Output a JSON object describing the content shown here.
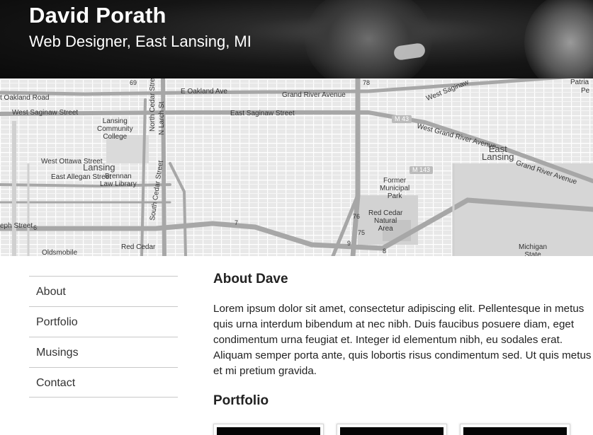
{
  "header": {
    "title": "David Porath",
    "subtitle": "Web Designer, East Lansing, MI"
  },
  "map": {
    "labels": {
      "oakland_road": "t Oakland Road",
      "e_oakland": "E Oakland Ave",
      "grand_river_1": "Grand River Avenue",
      "west_saginaw_tr": "West Saginaw",
      "patria": "Patria",
      "pe": "Pe",
      "west_saginaw_st": "West Saginaw Street",
      "east_saginaw_st": "East Saginaw Street",
      "m43": "M 43",
      "w_grand_river": "West Grand River Avenue",
      "lansing_cc": "Lansing\nCommunity\nCollege",
      "north_cedar": "North Cedar Street",
      "n_larch": "N Larch St",
      "east_lansing": "East\nLansing",
      "grand_river_ave": "Grand River Avenue",
      "west_ottawa": "West Ottawa Street",
      "lansing": "Lansing",
      "east_allegan": "East Allegan Street",
      "brennan": "Brennan\nLaw Library",
      "south_cedar": "South Cedar Street",
      "former_park": "Former\nMunicipal\nPark",
      "m143": "M 143",
      "red_cedar_area": "Red Cedar\nNatural\nArea",
      "eph_street": "eph Street",
      "red_cedar": "Red Cedar",
      "oldsmobile": "Oldsmobile",
      "michigan_state": "Michigan\nState",
      "route_69": "69",
      "route_78": "78",
      "route_76": "76",
      "route_75": "75",
      "route_7": "7",
      "route_9": "9",
      "route_8": "8",
      "route_6": "6"
    }
  },
  "nav": {
    "items": [
      {
        "label": "About"
      },
      {
        "label": "Portfolio"
      },
      {
        "label": "Musings"
      },
      {
        "label": "Contact"
      }
    ]
  },
  "about": {
    "title": "About Dave",
    "body": "Lorem ipsum dolor sit amet, consectetur adipiscing elit. Pellentesque in metus quis urna interdum bibendum at nec nibh. Duis faucibus posuere diam, eget condimentum urna feugiat et. Integer id elementum nibh, eu sodales erat. Aliquam semper porta ante, quis lobortis risus condimentum sed. Ut quis metus et mi pretium gravida."
  },
  "portfolio": {
    "title": "Portfolio"
  }
}
